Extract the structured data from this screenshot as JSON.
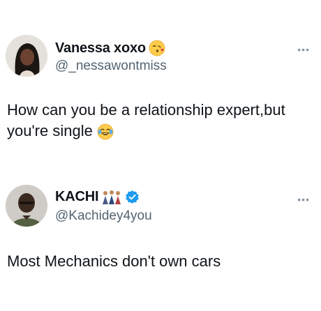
{
  "tweets": [
    {
      "display_name": "Vanessa xoxo",
      "name_emoji_icon": "face-blowing-kiss-emoji",
      "handle": "@_nessawontmiss",
      "more_icon": "more-options-icon",
      "text": "How can you be a relationship expert,but you're single",
      "text_emoji_icon": "face-with-tears-of-joy-emoji"
    },
    {
      "display_name": "KACHI",
      "name_emoji_icon": "people-figures-emoji",
      "verified_icon": "verified-badge-icon",
      "handle": "@Kachidey4you",
      "more_icon": "more-options-icon",
      "text": "Most Mechanics don't own cars"
    }
  ],
  "colors": {
    "text": "#0f1419",
    "handle": "#536471",
    "verified": "#1d9bf0",
    "more": "#8b98a5"
  }
}
